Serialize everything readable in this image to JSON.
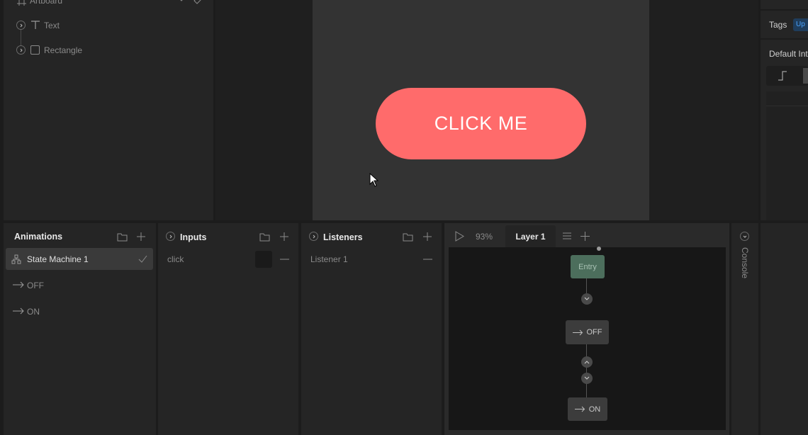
{
  "hierarchy": {
    "artboard_label": "Artboard",
    "items": [
      {
        "label": "Text"
      },
      {
        "label": "Rectangle"
      }
    ]
  },
  "canvas": {
    "button_label": "CLICK ME",
    "button_color": "#ff6b6b",
    "artboard_color": "#333333"
  },
  "inspector": {
    "tags_label": "Tags",
    "tags_badge": "Up",
    "default_label": "Default Int"
  },
  "animations": {
    "title": "Animations",
    "items": [
      {
        "label": "State Machine 1"
      },
      {
        "label": "OFF"
      },
      {
        "label": "ON"
      }
    ]
  },
  "inputs": {
    "title": "Inputs",
    "items": [
      {
        "label": "click"
      }
    ]
  },
  "listeners": {
    "title": "Listeners",
    "items": [
      {
        "label": "Listener 1"
      }
    ]
  },
  "graph": {
    "zoom": "93%",
    "layer_tab": "Layer 1",
    "nodes": {
      "entry": "Entry",
      "off": "OFF",
      "on": "ON"
    },
    "entry_color": "#4c6e5c"
  },
  "console": {
    "label": "Console"
  }
}
